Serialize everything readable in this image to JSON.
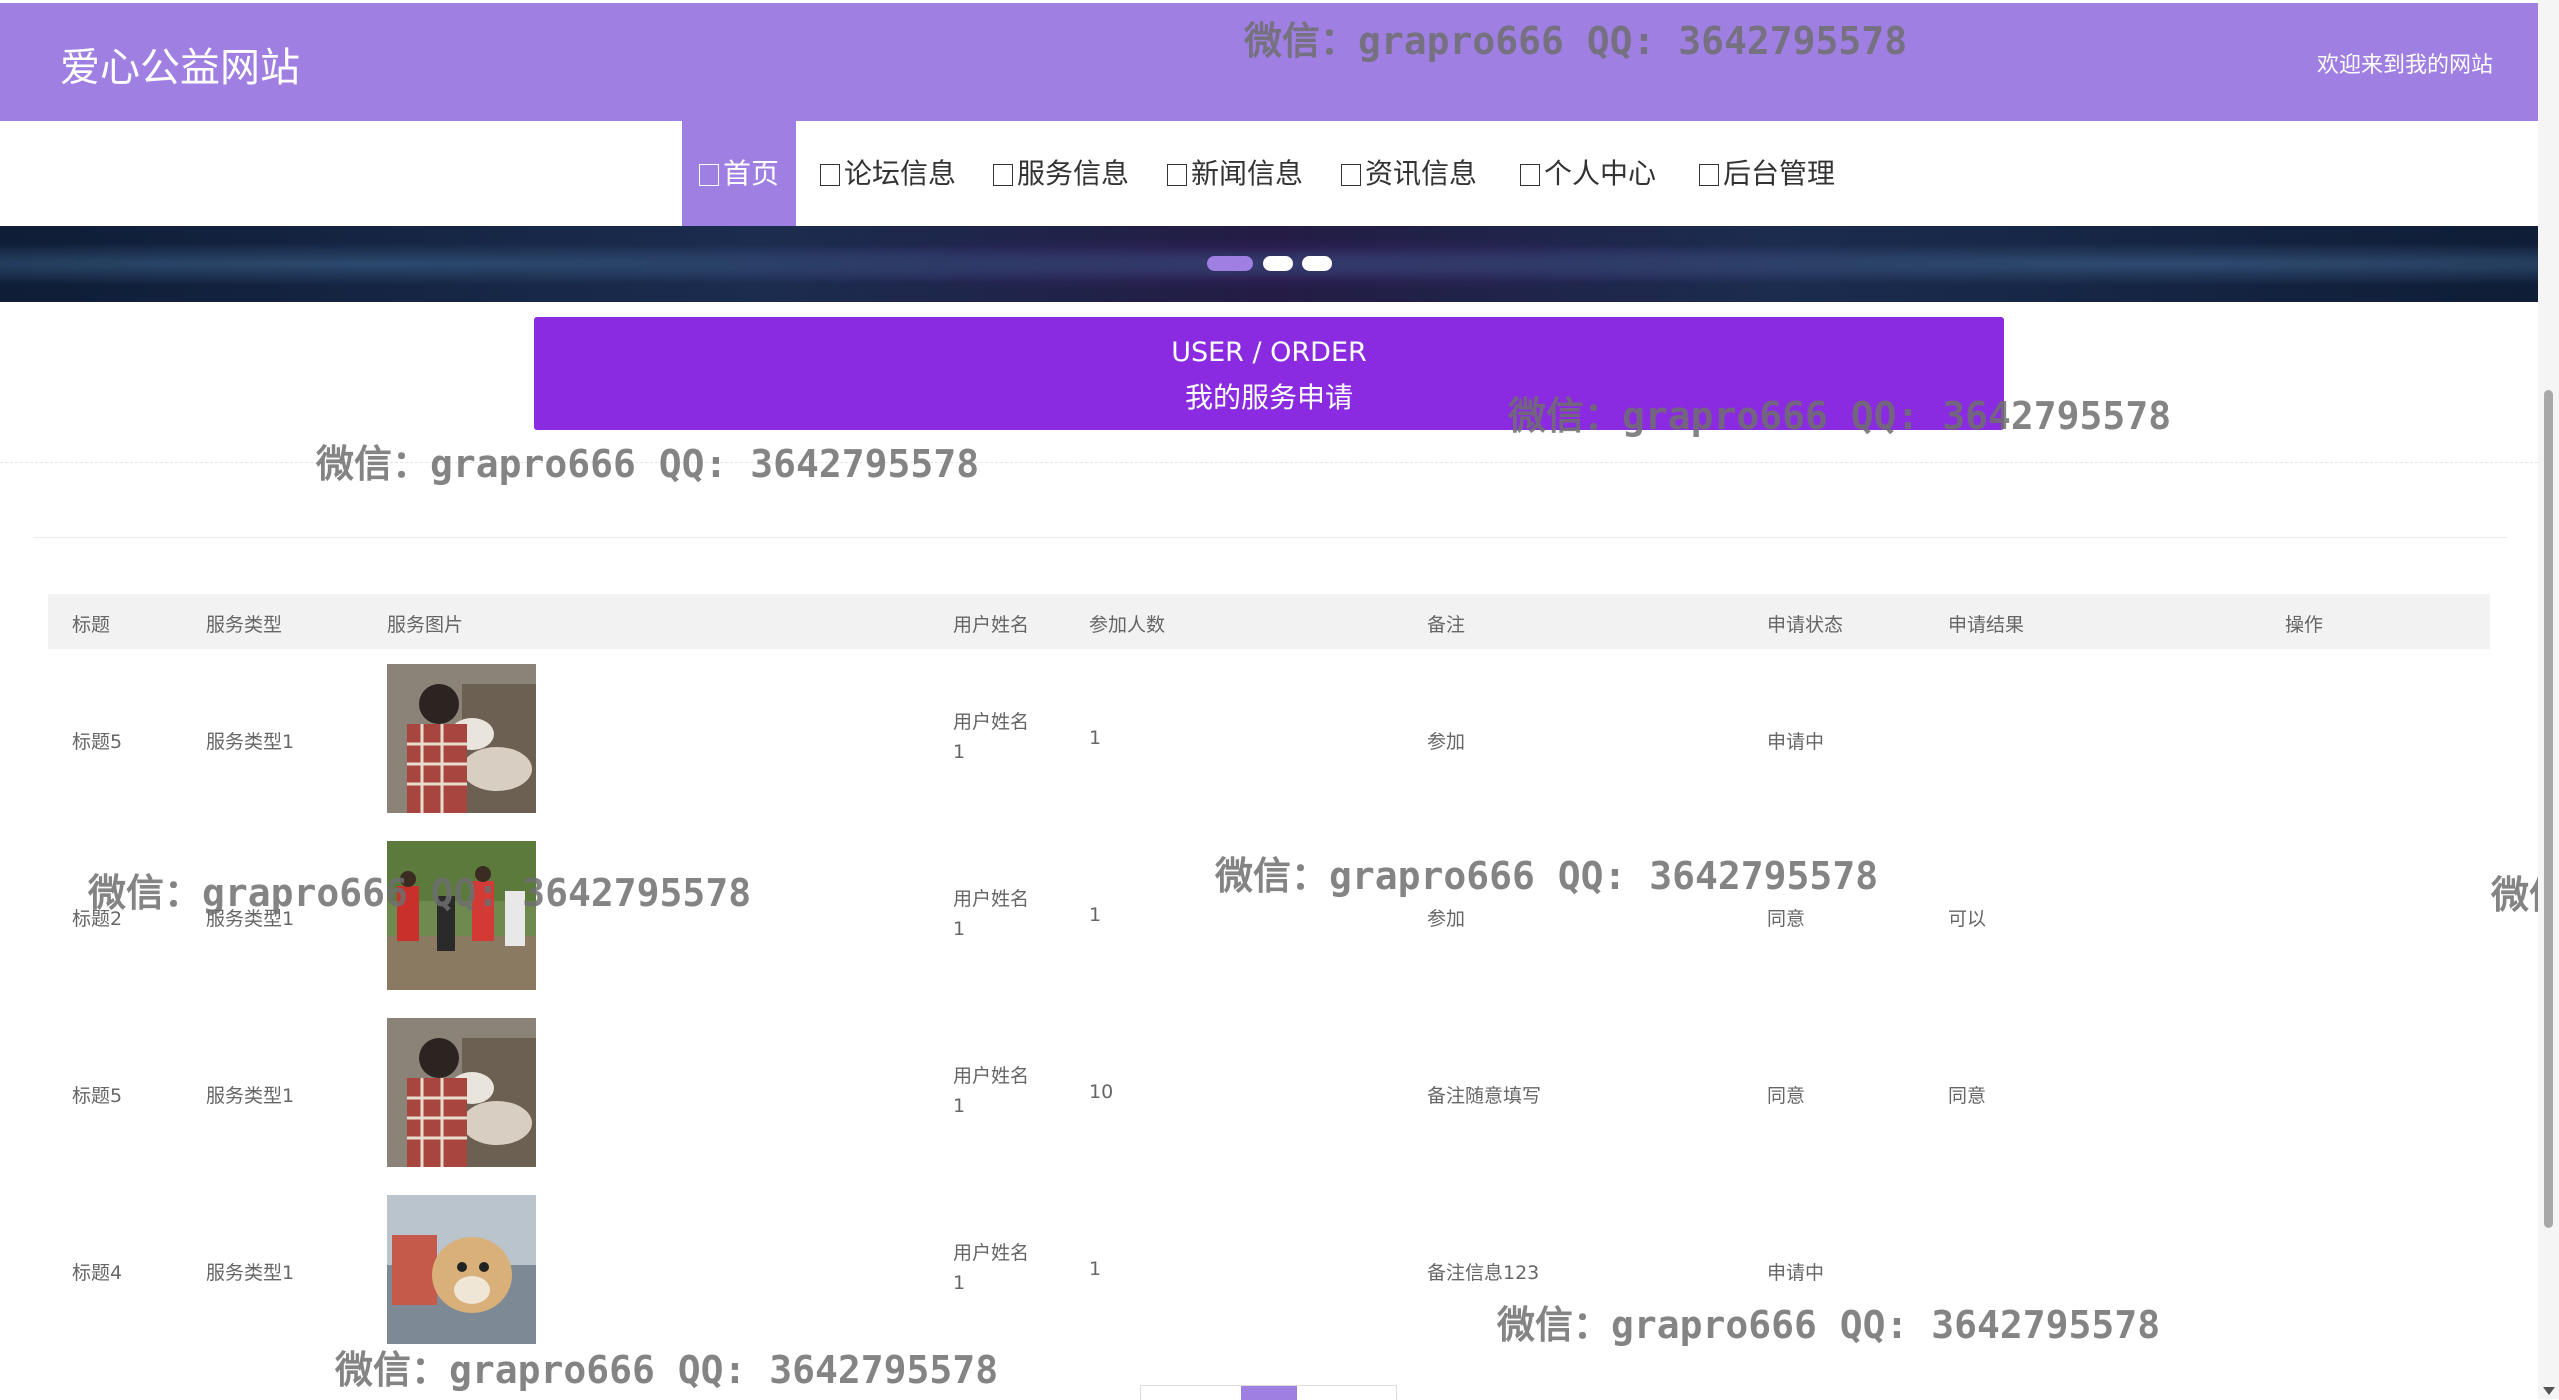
{
  "header": {
    "site_title": "爱心公益网站",
    "welcome": "欢迎来到我的网站"
  },
  "nav": [
    {
      "label": "首页",
      "active": true
    },
    {
      "label": "论坛信息"
    },
    {
      "label": "服务信息"
    },
    {
      "label": "新闻信息"
    },
    {
      "label": "资讯信息"
    },
    {
      "label": "个人中心"
    },
    {
      "label": "后台管理"
    }
  ],
  "section": {
    "en": "USER / ORDER",
    "cn": "我的服务申请"
  },
  "table": {
    "headers": [
      "标题",
      "服务类型",
      "服务图片",
      "用户姓名",
      "参加人数",
      "备注",
      "申请状态",
      "申请结果",
      "操作"
    ],
    "rows": [
      {
        "title": "标题5",
        "type": "服务类型1",
        "image": "volunteer-with-dogs-photo",
        "user_l1": "用户姓名",
        "user_l2": "1",
        "count": "1",
        "remark": "参加",
        "status": "申请中",
        "result": ""
      },
      {
        "title": "标题2",
        "type": "服务类型1",
        "image": "volunteers-outdoors-photo",
        "user_l1": "用户姓名",
        "user_l2": "1",
        "count": "1",
        "remark": "参加",
        "status": "同意",
        "result": "可以"
      },
      {
        "title": "标题5",
        "type": "服务类型1",
        "image": "volunteer-with-dogs-photo",
        "user_l1": "用户姓名",
        "user_l2": "1",
        "count": "10",
        "remark": "备注随意填写",
        "status": "同意",
        "result": "同意"
      },
      {
        "title": "标题4",
        "type": "服务类型1",
        "image": "person-holding-dog-photo",
        "user_l1": "用户姓名",
        "user_l2": "1",
        "count": "1",
        "remark": "备注信息123",
        "status": "申请中",
        "result": ""
      }
    ]
  },
  "watermark": "微信：grapro666 QQ: 3642795578",
  "watermark_partial": "微信",
  "colors": {
    "accent": "#a07fe2",
    "section_bg": "#8a2be2"
  }
}
